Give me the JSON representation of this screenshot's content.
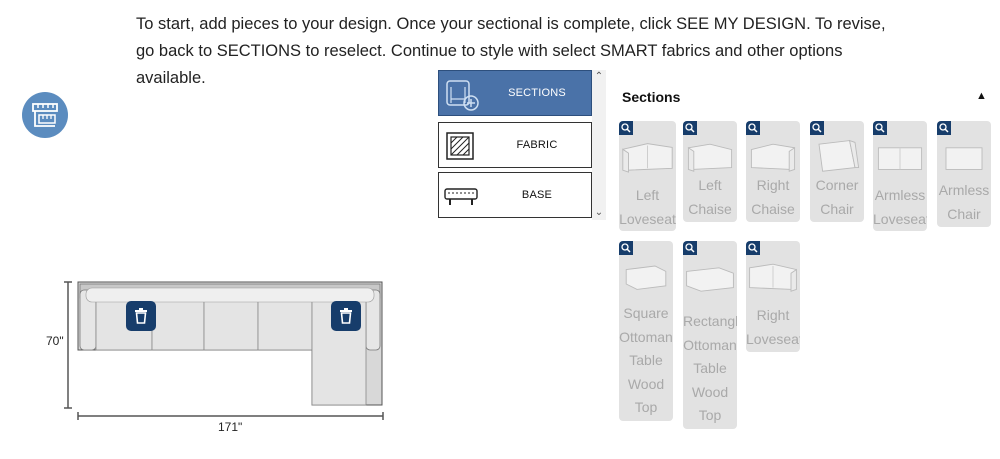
{
  "instructions": "To start, add pieces to your design. Once your sectional is complete, click SEE MY DESIGN. To revise, go back to SECTIONS to reselect. Continue to style with select SMART fabrics and other options available.",
  "measure_button": {
    "icon": "tape-measure-icon"
  },
  "sofa": {
    "height_label": "70\"",
    "width_label": "171\"",
    "delete_icon": "trash-icon"
  },
  "tabs": [
    {
      "label": "SECTIONS",
      "icon": "sections-icon",
      "active": true
    },
    {
      "label": "FABRIC",
      "icon": "fabric-icon",
      "active": false
    },
    {
      "label": "BASE",
      "icon": "base-icon",
      "active": false
    }
  ],
  "panel": {
    "title": "Sections",
    "collapse_icon": "chevron-up-icon"
  },
  "sections": [
    {
      "label": "Left Loveseat"
    },
    {
      "label": "Left Chaise"
    },
    {
      "label": "Right Chaise"
    },
    {
      "label": "Corner Chair"
    },
    {
      "label": "Armless Loveseat"
    },
    {
      "label": "Armless Chair"
    },
    {
      "label": "Square Ottoman Table Wood Top"
    },
    {
      "label": "Rectangle Ottoman Table Wood Top"
    },
    {
      "label": "Right Loveseat"
    }
  ],
  "colors": {
    "accent": "#4a72a8",
    "dark_accent": "#173d6b",
    "card_bg": "#e2e2e2",
    "card_text": "#a9a9a9"
  }
}
